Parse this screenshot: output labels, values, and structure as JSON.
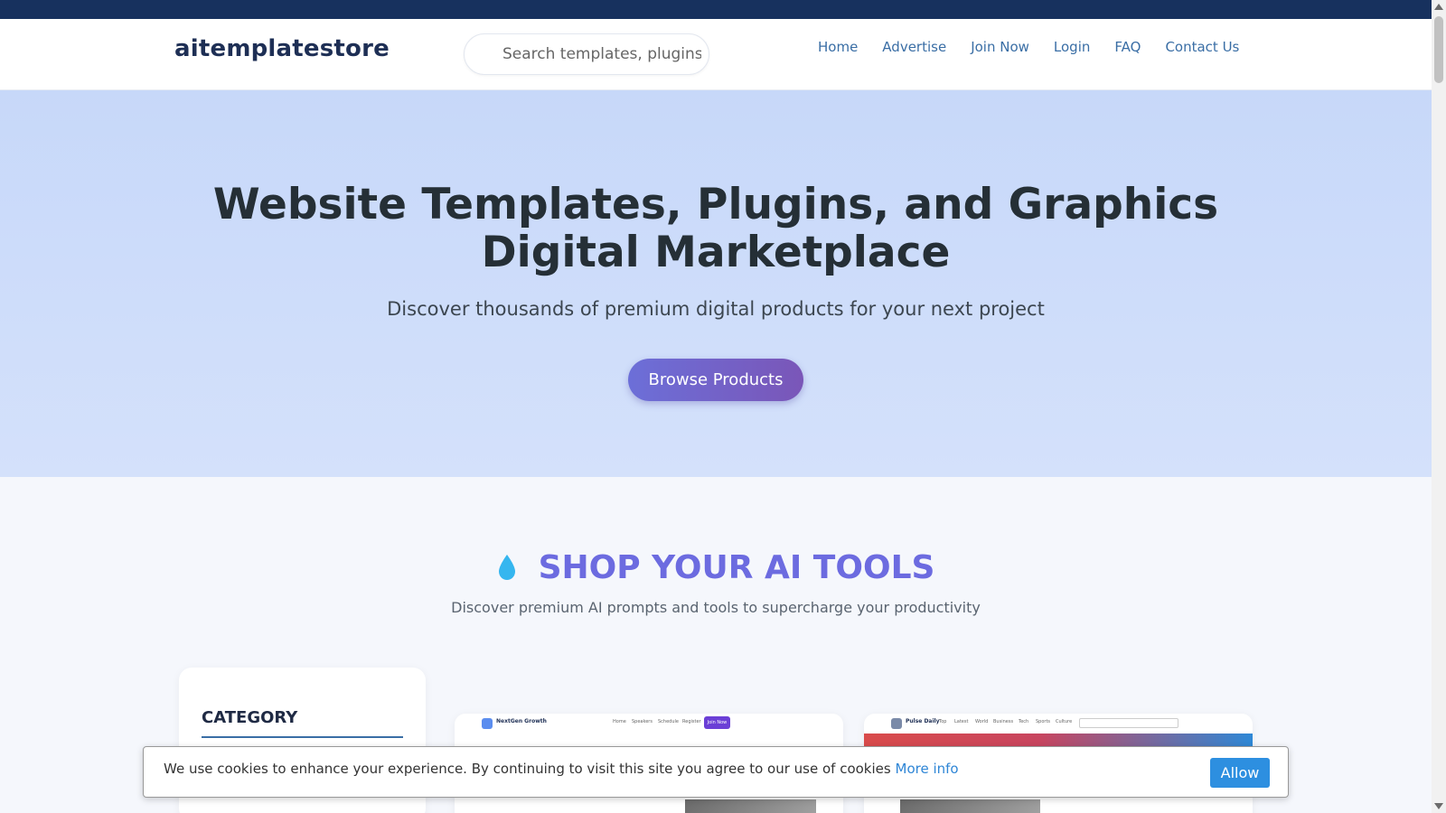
{
  "header": {
    "logo": "aitemplatestore",
    "search_placeholder": "Search templates, plugins...",
    "nav": [
      "Home",
      "Advertise",
      "Join Now",
      "Login",
      "FAQ",
      "Contact Us"
    ]
  },
  "hero": {
    "title_line1": "Website Templates, Plugins, and Graphics",
    "title_line2": "Digital Marketplace",
    "subtitle": "Discover thousands of premium digital products for your next project",
    "button": "Browse Products"
  },
  "shop": {
    "icon": "water-drop-icon",
    "title": "SHOP YOUR AI TOOLS",
    "subtitle": "Discover premium AI prompts and tools to supercharge your productivity"
  },
  "sidebar": {
    "category_title": "CATEGORY"
  },
  "products": [
    {
      "brand": "NextGen Growth",
      "links": [
        "Home",
        "Speakers",
        "Schedule",
        "Register"
      ],
      "cta": "Join Now"
    },
    {
      "brand": "Pulse Daily",
      "links": [
        "Top",
        "Latest",
        "World",
        "Business",
        "Tech",
        "Sports",
        "Culture"
      ]
    }
  ],
  "cookie": {
    "message": "We use cookies to enhance your experience. By continuing to visit this site you agree to our use of cookies",
    "more_info": "More info",
    "allow": "Allow"
  },
  "colors": {
    "topbar": "#17315e",
    "accent": "#6c6be0",
    "link": "#3a6ea5",
    "button": "#2d8fe0"
  }
}
